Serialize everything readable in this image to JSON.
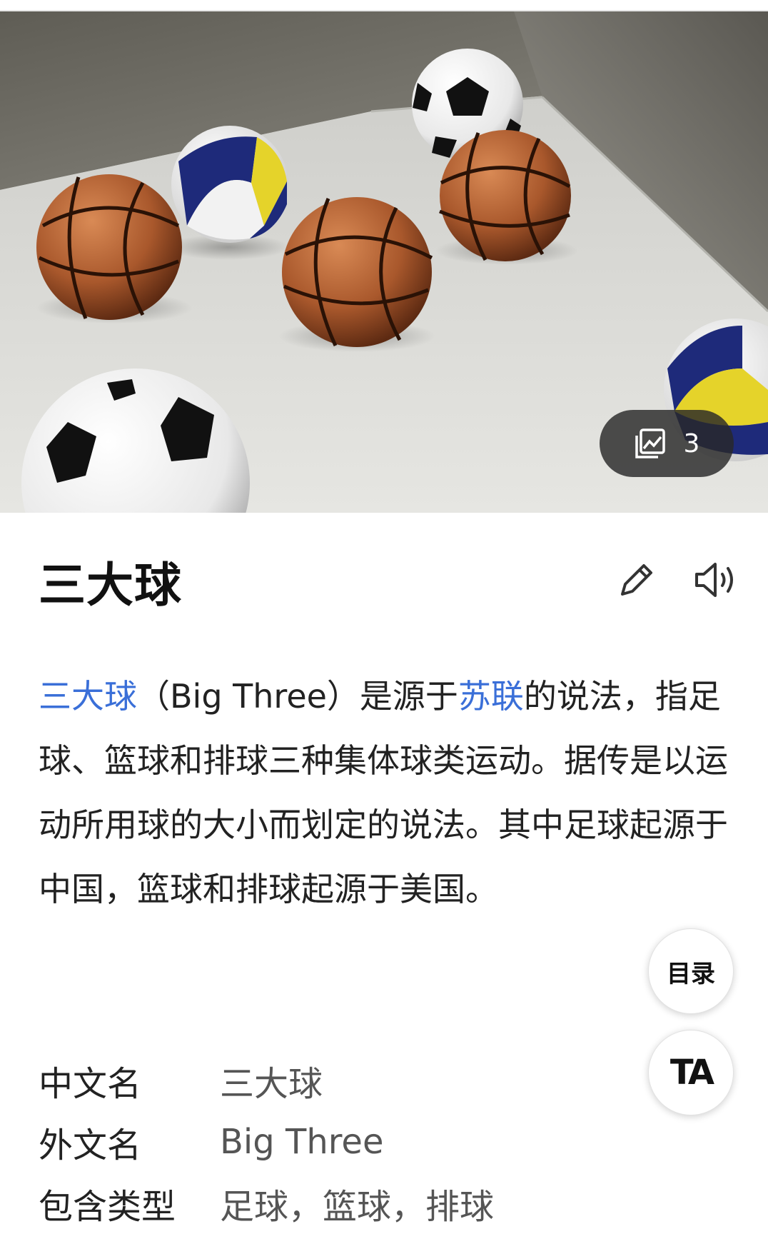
{
  "hero": {
    "image_description": "photo of three soccer balls, three basketballs and two volleyballs on a grey floor in a corner",
    "photo_count": "3",
    "photo_icon": "gallery-icon"
  },
  "article": {
    "title": "三大球",
    "edit_icon": "pencil-icon",
    "speak_icon": "speaker-icon",
    "summary": {
      "part1_link": "三大球",
      "part2": "（Big Three）是源于",
      "part3_link": "苏联",
      "part4": "的说法，指足球、篮球和排球三种集体球类运动。据传是以运动所用球的大小而划定的说法。其中足球起源于中国，篮球和排球起源于美国。"
    }
  },
  "fabs": {
    "toc_label": "目录",
    "ta_label": "TA"
  },
  "infobox": {
    "rows": [
      {
        "key": "中文名",
        "value": "三大球"
      },
      {
        "key": "外文名",
        "value": "Big Three"
      },
      {
        "key": "包含类型",
        "value": "足球，篮球，排球"
      }
    ]
  },
  "colors": {
    "link": "#3a6fd8",
    "title": "#111111",
    "text": "#222222"
  }
}
